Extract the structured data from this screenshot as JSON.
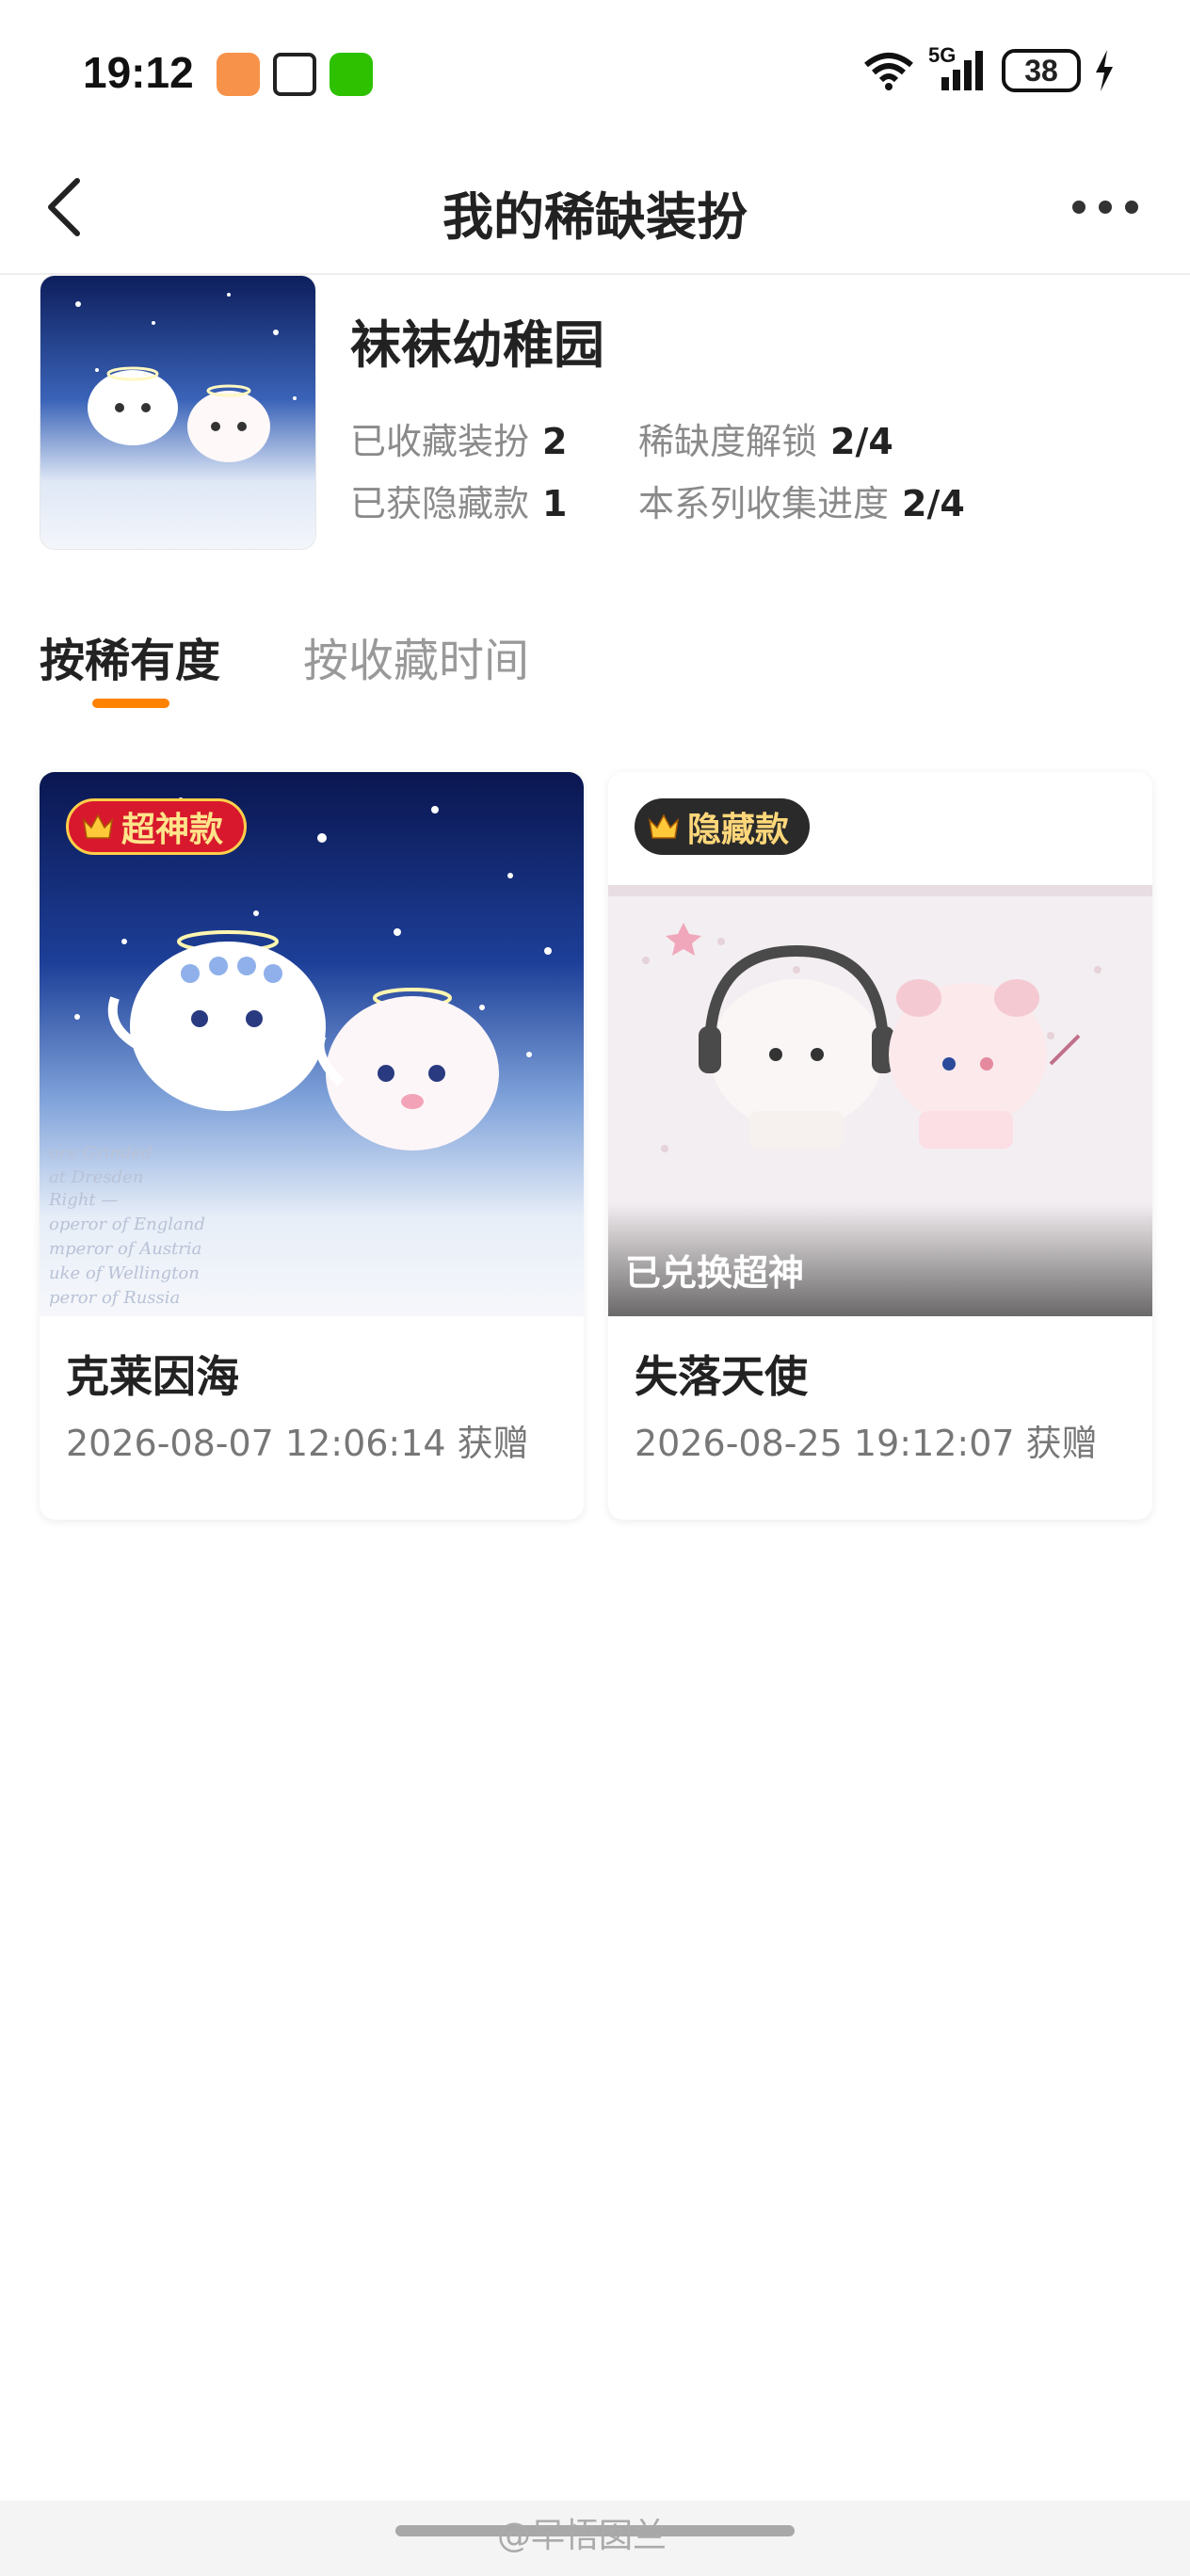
{
  "status_bar": {
    "time": "19:12",
    "network": "5G",
    "battery": "38"
  },
  "nav": {
    "title": "我的稀缺装扮"
  },
  "series": {
    "title": "袜袜幼稚园",
    "stats": [
      {
        "label": "已收藏装扮",
        "value": "2"
      },
      {
        "label": "稀缺度解锁",
        "value": "2/4"
      },
      {
        "label": "已获隐藏款",
        "value": "1"
      },
      {
        "label": "本系列收集进度",
        "value": "2/4"
      }
    ]
  },
  "tabs": [
    {
      "label": "按稀有度",
      "active": true
    },
    {
      "label": "按收藏时间",
      "active": false
    }
  ],
  "cards": [
    {
      "badge": "超神款",
      "name": "克莱因海",
      "date": "2026-08-07 12:06:14 获赠",
      "overlay": ""
    },
    {
      "badge": "隐藏款",
      "name": "失落天使",
      "date": "2026-08-25 19:12:07 获赠",
      "overlay": "已兑换超神"
    }
  ],
  "watermark": "@早悟囡兰",
  "colors": {
    "accent": "#ff8200",
    "badge_red": "#d8192d",
    "badge_dark": "#2a2a2a"
  }
}
